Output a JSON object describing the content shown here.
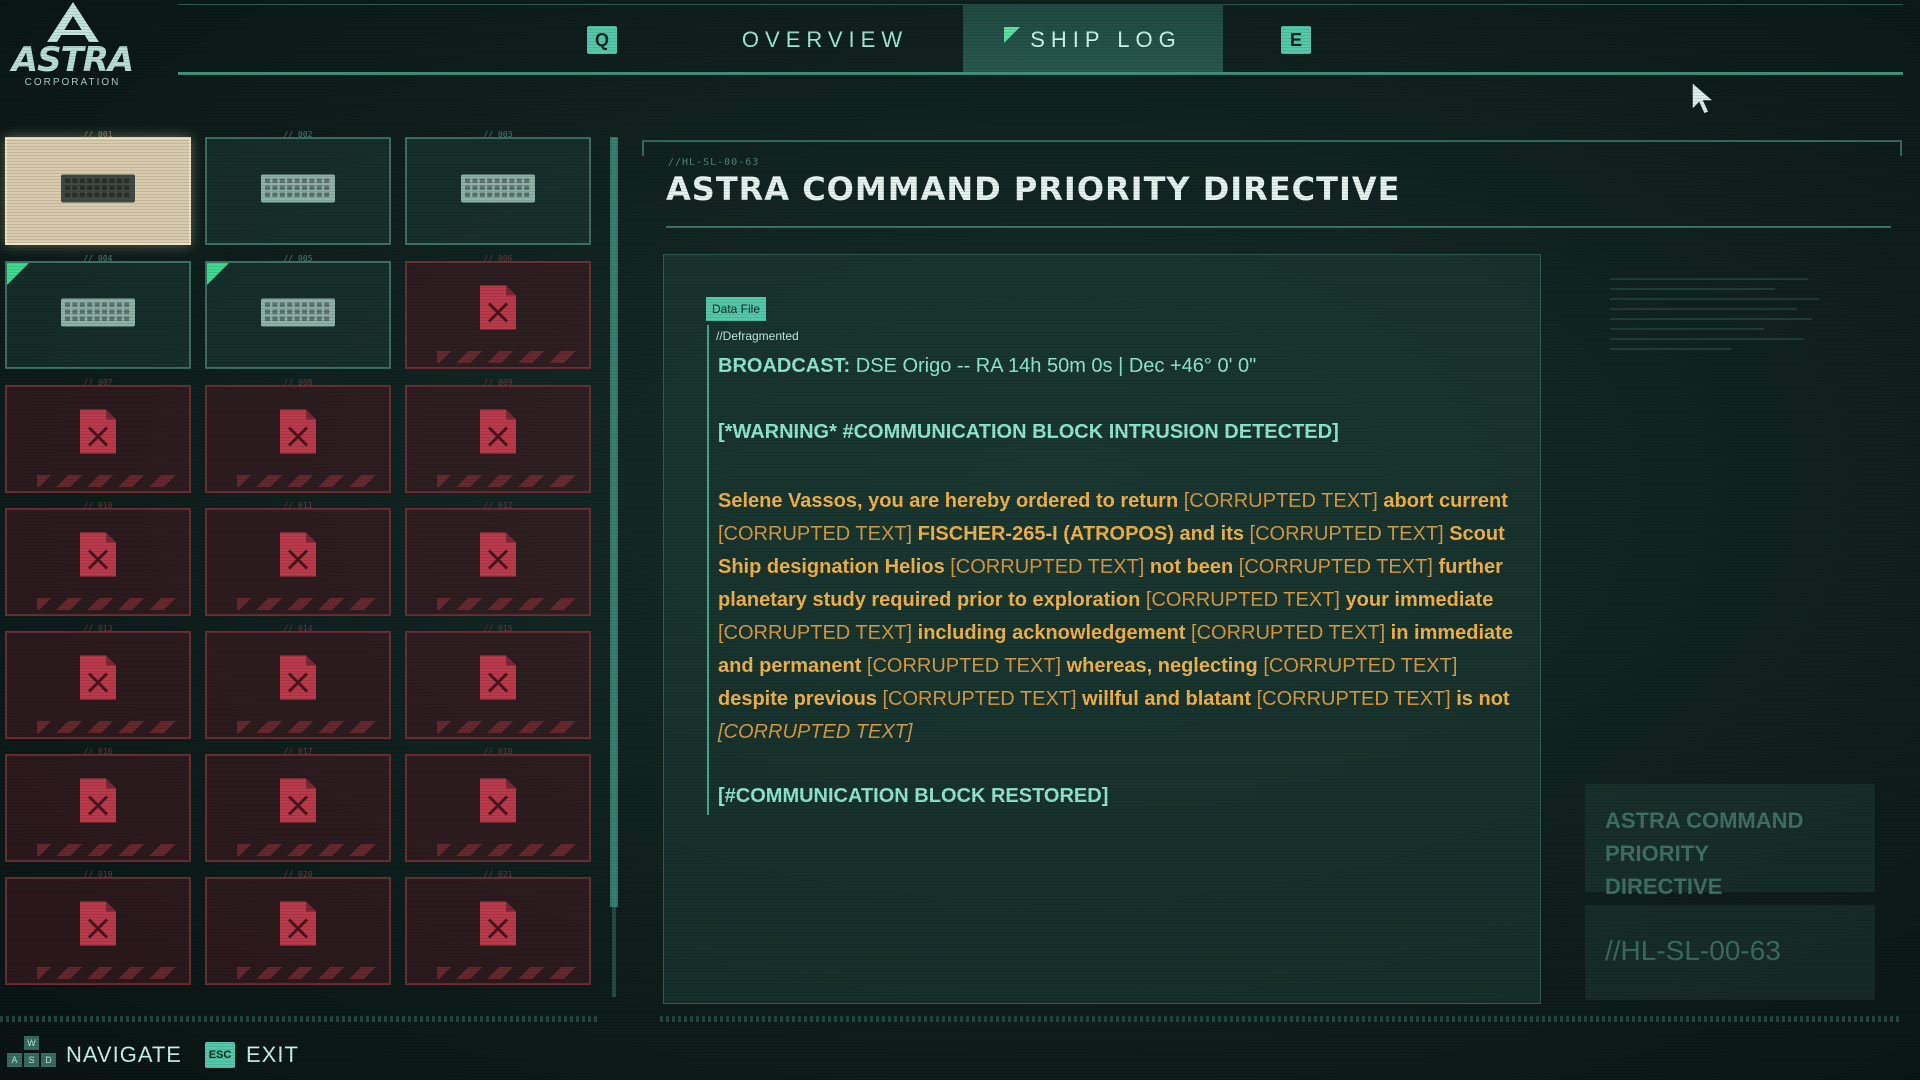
{
  "brand": {
    "name": "ASTRA",
    "sub": "CORPORATION"
  },
  "header": {
    "prev_key": "Q",
    "next_key": "E",
    "tabs": [
      {
        "label": "OVERVIEW",
        "active": false
      },
      {
        "label": "SHIP LOG",
        "active": true
      }
    ]
  },
  "grid": {
    "slots": [
      {
        "num": "// 001",
        "state": "unlocked",
        "selected": true
      },
      {
        "num": "// 002",
        "state": "unlocked"
      },
      {
        "num": "// 003",
        "state": "unlocked"
      },
      {
        "num": "// 004",
        "state": "unlocked",
        "new": true
      },
      {
        "num": "// 005",
        "state": "unlocked",
        "new": true
      },
      {
        "num": "// 006",
        "state": "locked"
      },
      {
        "num": "// 007",
        "state": "locked"
      },
      {
        "num": "// 008",
        "state": "locked"
      },
      {
        "num": "// 009",
        "state": "locked"
      },
      {
        "num": "// 010",
        "state": "locked"
      },
      {
        "num": "// 011",
        "state": "locked"
      },
      {
        "num": "// 012",
        "state": "locked"
      },
      {
        "num": "// 013",
        "state": "locked"
      },
      {
        "num": "// 014",
        "state": "locked"
      },
      {
        "num": "// 015",
        "state": "locked"
      },
      {
        "num": "// 016",
        "state": "locked"
      },
      {
        "num": "// 017",
        "state": "locked"
      },
      {
        "num": "// 018",
        "state": "locked"
      },
      {
        "num": "// 019",
        "state": "locked"
      },
      {
        "num": "// 020",
        "state": "locked"
      },
      {
        "num": "// 021",
        "state": "locked"
      }
    ]
  },
  "log": {
    "id": "//HL-SL-00-63",
    "title": "ASTRA COMMAND PRIORITY DIRECTIVE",
    "badge": "Data File",
    "status": "//Defragmented",
    "broadcast_label": "BROADCAST:",
    "broadcast_value": "DSE Origo -- RA 14h 50m 0s | Dec +46° 0' 0\"",
    "warning": "[*WARNING* #COMMUNICATION BLOCK INTRUSION DETECTED]",
    "message": [
      {
        "t": "Selene Vassos, you are hereby ordered to return ",
        "k": "n"
      },
      {
        "t": "[CORRUPTED TEXT]",
        "k": "c"
      },
      {
        "t": " abort current ",
        "k": "n"
      },
      {
        "t": "[CORRUPTED TEXT]",
        "k": "c"
      },
      {
        "t": " FISCHER-265-I (ATROPOS) and its ",
        "k": "n"
      },
      {
        "t": "[CORRUPTED TEXT]",
        "k": "c"
      },
      {
        "t": " Scout Ship designation Helios ",
        "k": "n"
      },
      {
        "t": "[CORRUPTED TEXT]",
        "k": "c"
      },
      {
        "t": " not been ",
        "k": "n"
      },
      {
        "t": "[CORRUPTED TEXT]",
        "k": "c"
      },
      {
        "t": " further planetary study required prior to exploration ",
        "k": "n"
      },
      {
        "t": "[CORRUPTED TEXT]",
        "k": "c"
      },
      {
        "t": " your immediate ",
        "k": "n"
      },
      {
        "t": "[CORRUPTED TEXT]",
        "k": "c"
      },
      {
        "t": " including acknowledgement ",
        "k": "n"
      },
      {
        "t": "[CORRUPTED TEXT]",
        "k": "c"
      },
      {
        "t": " in immediate and permanent ",
        "k": "n"
      },
      {
        "t": "[CORRUPTED TEXT]",
        "k": "c"
      },
      {
        "t": " whereas, neglecting ",
        "k": "n"
      },
      {
        "t": "[CORRUPTED TEXT]",
        "k": "c"
      },
      {
        "t": " despite previous ",
        "k": "n"
      },
      {
        "t": "[CORRUPTED TEXT]",
        "k": "c"
      },
      {
        "t": " willful and blatant ",
        "k": "n"
      },
      {
        "t": "[CORRUPTED TEXT]",
        "k": "c"
      },
      {
        "t": " is not ",
        "k": "n"
      },
      {
        "t": "[CORRUPTED TEXT]",
        "k": "cl"
      }
    ],
    "restored": "[#COMMUNICATION BLOCK RESTORED]"
  },
  "side": {
    "title": "ASTRA COMMAND PRIORITY DIRECTIVE",
    "id": "//HL-SL-00-63"
  },
  "footer": {
    "nav_keys": [
      "W",
      "A",
      "S",
      "D"
    ],
    "nav_label": "NAVIGATE",
    "exit_key": "ESC",
    "exit_label": "EXIT"
  },
  "colors": {
    "accent": "#55c8a9",
    "selected": "#d8cbae",
    "locked": "#6e2d34",
    "message": "#f0b24a",
    "new_flag": "#3fd990"
  }
}
